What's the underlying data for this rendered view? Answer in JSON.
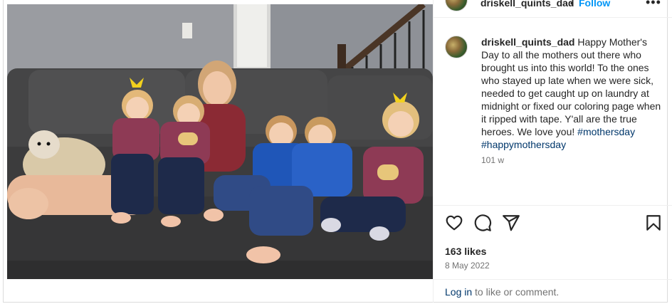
{
  "post": {
    "username": "driskell_quints_dad",
    "separator": "•",
    "follow_label": "Follow",
    "more_label": "•••",
    "caption_user": "driskell_quints_dad",
    "caption_text": "Happy Mother's Day to all the mothers out there who brought us into this world! To the ones who stayed up late when we were sick, needed to get caught up on laundry at midnight or fixed our coloring page when it ripped with tape. Y'all are the true heroes. We love you!",
    "hashtags": [
      "#mothersday",
      "#happymothersday"
    ],
    "age": "101 w",
    "likes": "163 likes",
    "date": "8 May 2022",
    "login_link": "Log in",
    "login_rest": " to like or comment."
  },
  "icons": {
    "like": "heart-icon",
    "comment": "comment-icon",
    "share": "share-icon",
    "save": "bookmark-icon"
  },
  "colors": {
    "follow": "#0095f6",
    "hashtag": "#00376b",
    "muted": "#737373"
  }
}
